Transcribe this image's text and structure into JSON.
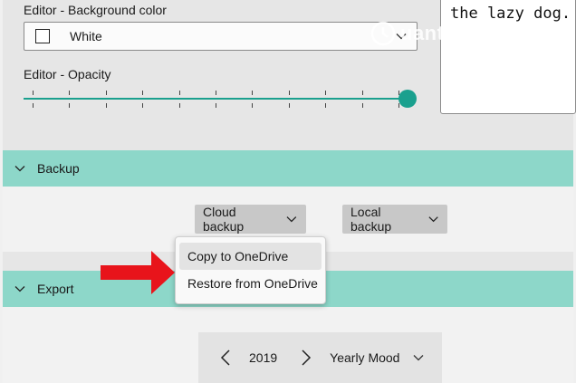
{
  "editor": {
    "bg_label": "Editor - Background color",
    "bg_value": "White",
    "opacity_label": "Editor - Opacity",
    "opacity_value": 1.0,
    "preview_text": "the lazy dog.",
    "accent_color": "#1aa08e"
  },
  "watermark": {
    "text": "uantrimang"
  },
  "backup": {
    "title": "Backup",
    "cloud_label": "Cloud backup",
    "local_label": "Local backup",
    "menu_items": [
      "Copy to OneDrive",
      "Restore from OneDrive"
    ]
  },
  "export": {
    "title": "Export",
    "year": "2019",
    "mode": "Yearly Mood"
  },
  "colors": {
    "section_header": "#8dd7c9",
    "annotation_arrow": "#e8141b"
  },
  "icons": {
    "select_chevron": "chevron-down-icon",
    "section_chevron": "chevron-down-icon",
    "year_prev": "chevron-left-icon",
    "year_next": "chevron-right-icon"
  }
}
